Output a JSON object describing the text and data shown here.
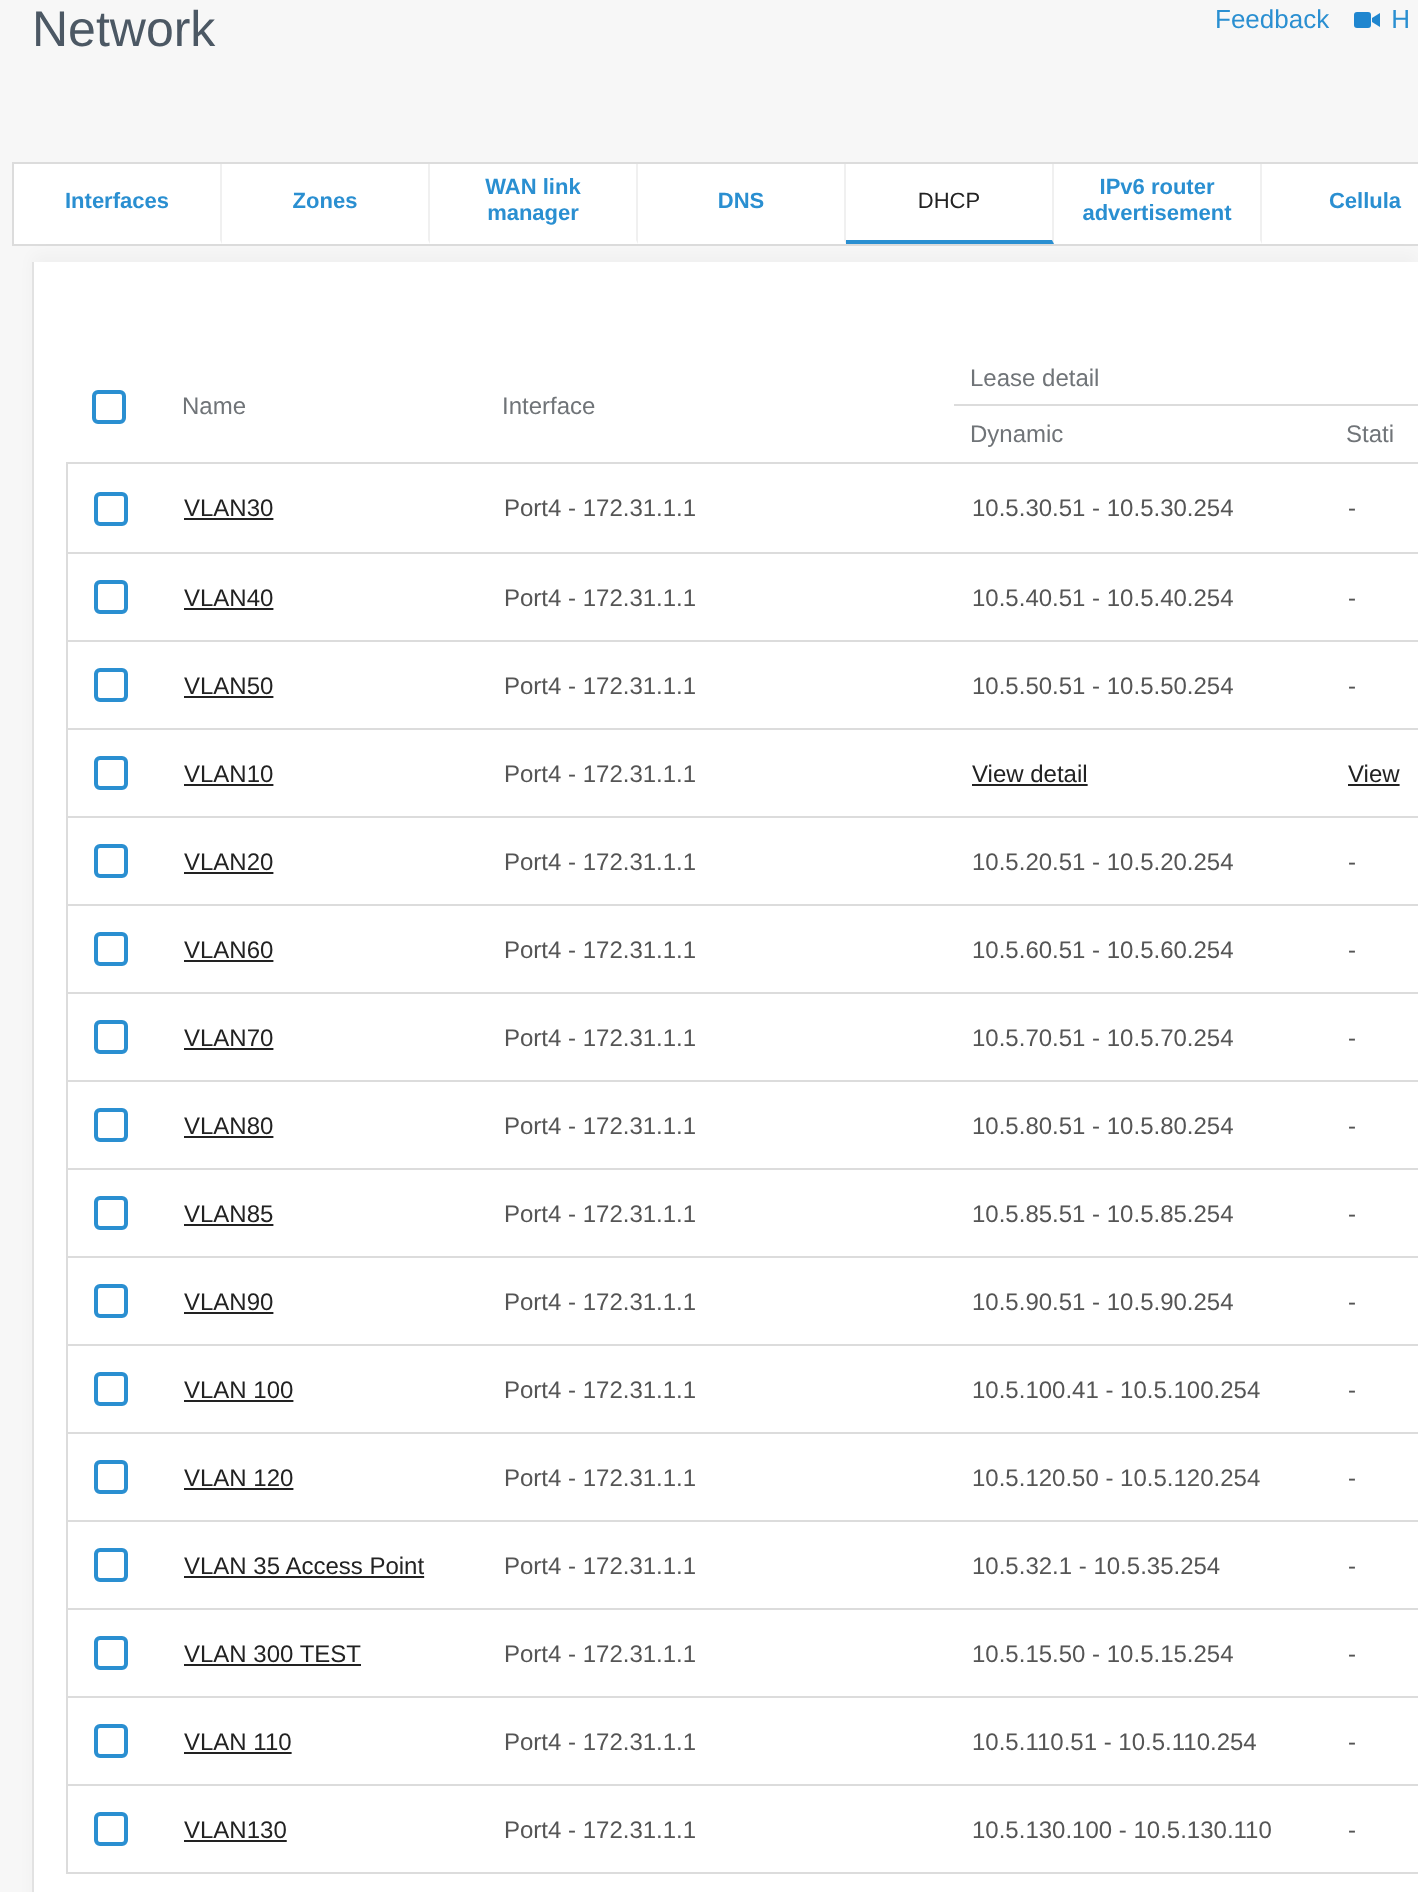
{
  "page": {
    "title": "Network",
    "links": [
      {
        "kind": "text",
        "label": "Feedback"
      },
      {
        "kind": "video",
        "label": "H"
      }
    ]
  },
  "tabs": [
    {
      "label": "Interfaces",
      "selected": false
    },
    {
      "label": "Zones",
      "selected": false
    },
    {
      "label": "WAN link manager",
      "selected": false
    },
    {
      "label": "DNS",
      "selected": false
    },
    {
      "label": "DHCP",
      "selected": true
    },
    {
      "label": "IPv6 router advertisement",
      "selected": false
    },
    {
      "label": "Cellula",
      "selected": false
    }
  ],
  "table": {
    "select_all": {
      "checked": false
    },
    "columns": {
      "name": "Name",
      "interface": "Interface",
      "group": "Lease detail",
      "dynamic": "Dynamic",
      "static": "Stati"
    },
    "rows": [
      {
        "checked": false,
        "name": "VLAN30",
        "interface": "Port4 - 172.31.1.1",
        "dynamic": {
          "kind": "text",
          "text": "10.5.30.51 - 10.5.30.254"
        },
        "static": {
          "kind": "text",
          "text": "-"
        }
      },
      {
        "checked": false,
        "name": "VLAN40",
        "interface": "Port4 - 172.31.1.1",
        "dynamic": {
          "kind": "text",
          "text": "10.5.40.51 - 10.5.40.254"
        },
        "static": {
          "kind": "text",
          "text": "-"
        }
      },
      {
        "checked": false,
        "name": "VLAN50",
        "interface": "Port4 - 172.31.1.1",
        "dynamic": {
          "kind": "text",
          "text": "10.5.50.51 - 10.5.50.254"
        },
        "static": {
          "kind": "text",
          "text": "-"
        }
      },
      {
        "checked": false,
        "name": "VLAN10",
        "interface": "Port4 - 172.31.1.1",
        "dynamic": {
          "kind": "link",
          "text": "View detail"
        },
        "static": {
          "kind": "link",
          "text": "View"
        }
      },
      {
        "checked": false,
        "name": "VLAN20",
        "interface": "Port4 - 172.31.1.1",
        "dynamic": {
          "kind": "text",
          "text": "10.5.20.51 - 10.5.20.254"
        },
        "static": {
          "kind": "text",
          "text": "-"
        }
      },
      {
        "checked": false,
        "name": "VLAN60",
        "interface": "Port4 - 172.31.1.1",
        "dynamic": {
          "kind": "text",
          "text": "10.5.60.51 - 10.5.60.254"
        },
        "static": {
          "kind": "text",
          "text": "-"
        }
      },
      {
        "checked": false,
        "name": "VLAN70",
        "interface": "Port4 - 172.31.1.1",
        "dynamic": {
          "kind": "text",
          "text": "10.5.70.51 - 10.5.70.254"
        },
        "static": {
          "kind": "text",
          "text": "-"
        }
      },
      {
        "checked": false,
        "name": "VLAN80",
        "interface": "Port4 - 172.31.1.1",
        "dynamic": {
          "kind": "text",
          "text": "10.5.80.51 - 10.5.80.254"
        },
        "static": {
          "kind": "text",
          "text": "-"
        }
      },
      {
        "checked": false,
        "name": "VLAN85",
        "interface": "Port4 - 172.31.1.1",
        "dynamic": {
          "kind": "text",
          "text": "10.5.85.51 - 10.5.85.254"
        },
        "static": {
          "kind": "text",
          "text": "-"
        }
      },
      {
        "checked": false,
        "name": "VLAN90",
        "interface": "Port4 - 172.31.1.1",
        "dynamic": {
          "kind": "text",
          "text": "10.5.90.51 - 10.5.90.254"
        },
        "static": {
          "kind": "text",
          "text": "-"
        }
      },
      {
        "checked": false,
        "name": "VLAN 100",
        "interface": "Port4 - 172.31.1.1",
        "dynamic": {
          "kind": "text",
          "text": "10.5.100.41 - 10.5.100.254"
        },
        "static": {
          "kind": "text",
          "text": "-"
        }
      },
      {
        "checked": false,
        "name": "VLAN 120",
        "interface": "Port4 - 172.31.1.1",
        "dynamic": {
          "kind": "text",
          "text": "10.5.120.50 - 10.5.120.254"
        },
        "static": {
          "kind": "text",
          "text": "-"
        }
      },
      {
        "checked": false,
        "name": "VLAN 35 Access Point",
        "interface": "Port4 - 172.31.1.1",
        "dynamic": {
          "kind": "text",
          "text": "10.5.32.1 - 10.5.35.254"
        },
        "static": {
          "kind": "text",
          "text": "-"
        }
      },
      {
        "checked": false,
        "name": "VLAN 300 TEST",
        "interface": "Port4 - 172.31.1.1",
        "dynamic": {
          "kind": "text",
          "text": "10.5.15.50 - 10.5.15.254"
        },
        "static": {
          "kind": "text",
          "text": "-"
        }
      },
      {
        "checked": false,
        "name": "VLAN 110",
        "interface": "Port4 - 172.31.1.1",
        "dynamic": {
          "kind": "text",
          "text": "10.5.110.51 - 10.5.110.254"
        },
        "static": {
          "kind": "text",
          "text": "-"
        }
      },
      {
        "checked": false,
        "name": "VLAN130",
        "interface": "Port4 - 172.31.1.1",
        "dynamic": {
          "kind": "text",
          "text": "10.5.130.100 - 10.5.130.110"
        },
        "static": {
          "kind": "text",
          "text": "-"
        }
      }
    ]
  }
}
